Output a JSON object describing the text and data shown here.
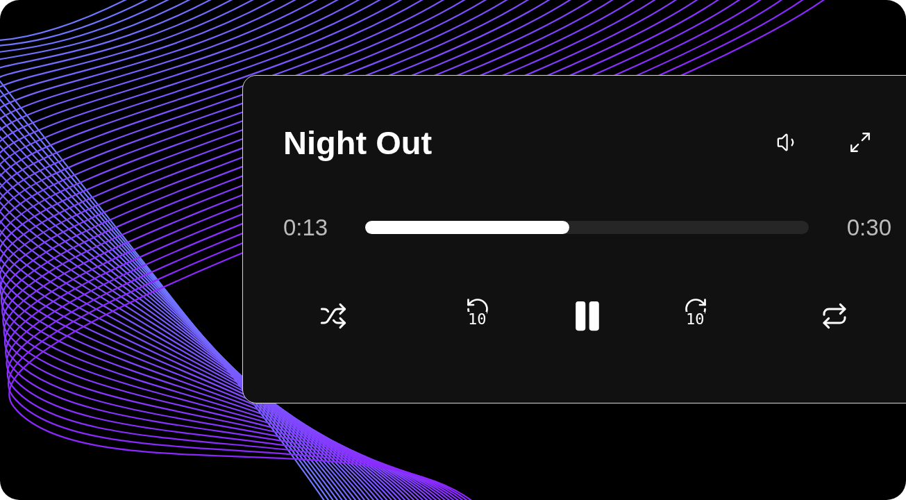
{
  "player": {
    "title": "Night Out",
    "elapsed": "0:13",
    "duration": "0:30",
    "progress": {
      "level": 0.46
    },
    "playing": true,
    "skip_back": {
      "label": "10"
    },
    "skip_forward": {
      "label": "10"
    }
  }
}
